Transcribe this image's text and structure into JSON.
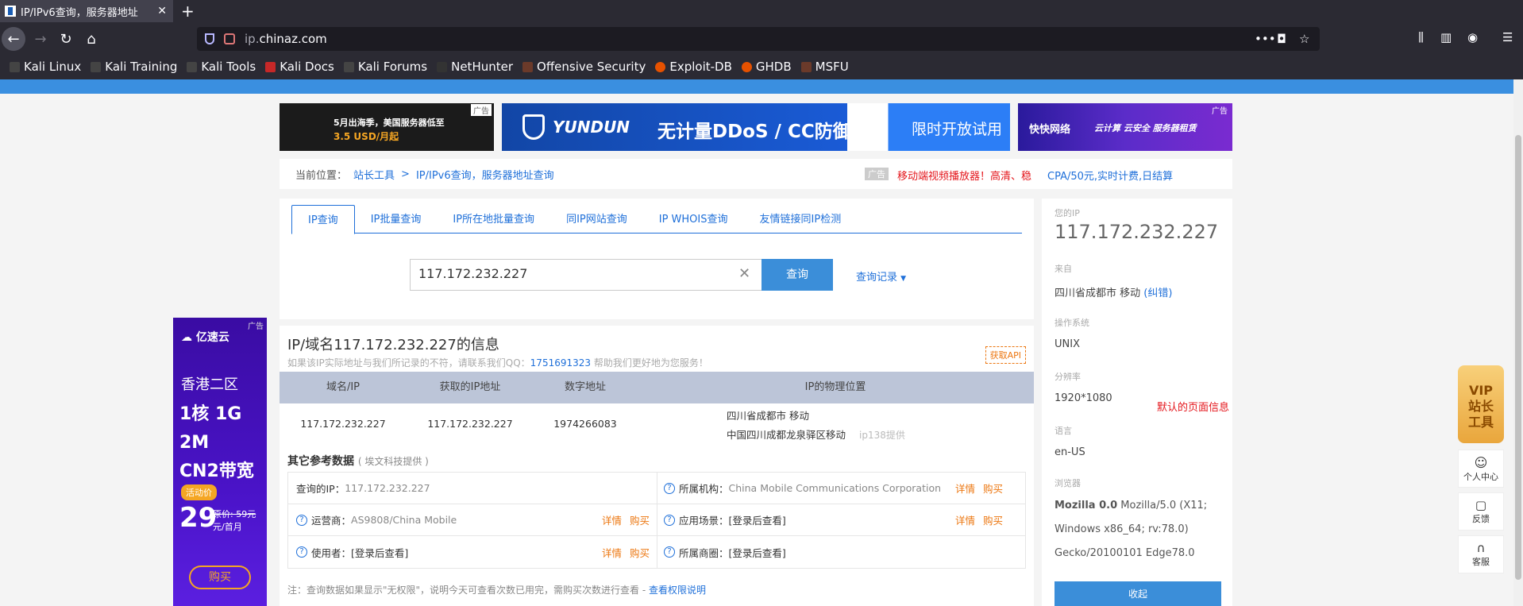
{
  "browser": {
    "tab_title": "IP/IPv6查询，服务器地址",
    "url_host": "ip.",
    "url_domain": "chinaz.com",
    "bookmarks": [
      "Kali Linux",
      "Kali Training",
      "Kali Tools",
      "Kali Docs",
      "Kali Forums",
      "NetHunter",
      "Offensive Security",
      "Exploit-DB",
      "GHDB",
      "MSFU"
    ]
  },
  "ads": {
    "top1_line1": "5月出海季，美国服务器低至",
    "top1_line2": "3.5 USD/月起",
    "top1_tag": "广告",
    "top2_brand": "YUNDUN",
    "top2_text": "无计量DDoS / CC防御",
    "top2_cta": "限时开放试用",
    "top3_brand": "快快网络",
    "top3_text": "云计算  云安全  服务器租赁",
    "left_brand": "亿速云",
    "left_t1": "香港二区",
    "left_t2a": "1核 1G 2M",
    "left_t2b": "CN2带宽",
    "left_badge": "活动价",
    "left_price": "29",
    "left_orig": "原价: 59元",
    "left_unit": "元/首月",
    "left_buy": "购买",
    "tag": "广告"
  },
  "crumb": {
    "label": "当前位置：",
    "home": "站长工具",
    "sep": ">",
    "current": "IP/IPv6查询，服务器地址查询",
    "tag": "广告",
    "red": "移动端视频播放器！高清、稳",
    "blue": "CPA/50元,实时计费,日结算"
  },
  "tabs": [
    "IP查询",
    "IP批量查询",
    "IP所在地批量查询",
    "同IP网站查询",
    "IP WHOIS查询",
    "友情链接同IP检测"
  ],
  "search": {
    "value": "117.172.232.227",
    "button": "查询",
    "history": "查询记录"
  },
  "info": {
    "title": "IP/域名117.172.232.227的信息",
    "note_pre": "如果该IP实际地址与我们所记录的不符，请联系我们QQ：",
    "qq": "1751691323",
    "note_post": " 帮助我们更好地为您服务！",
    "api": "获取API"
  },
  "table": {
    "headers": [
      "域名/IP",
      "获取的IP地址",
      "数字地址",
      "IP的物理位置"
    ],
    "row": [
      "117.172.232.227",
      "117.172.232.227",
      "1974266083"
    ],
    "loc1": "四川省成都市 移动",
    "loc2": "中国四川成都龙泉驿区移动",
    "source": "ip138提供"
  },
  "other": {
    "title": "其它参考数据",
    "source": "( 埃文科技提供 )",
    "q_ip_label": "查询的IP：",
    "q_ip": "117.172.232.227",
    "org_label": "所属机构：",
    "org": "China Mobile Communications Corporation",
    "isp_label": "运营商：",
    "isp": "AS9808/China Mobile",
    "scene_label": "应用场景：",
    "scene": "[登录后查看]",
    "user_label": "使用者：",
    "user": "[登录后查看]",
    "circle_label": "所属商圈：",
    "circle": "[登录后查看]",
    "detail": "详情",
    "buy": "购买"
  },
  "note": {
    "text": "注：查询数据如果显示\"无权限\"，说明今天可查看次数已用完，需购买次数进行查看 - ",
    "link": "查看权限说明"
  },
  "sidebar": {
    "your_ip_label": "您的IP",
    "your_ip": "117.172.232.227",
    "from_label": "来自",
    "from": "四川省成都市 移动",
    "fix": "(纠错)",
    "os_label": "操作系统",
    "os": "UNIX",
    "res_label": "分辨率",
    "res": "1920*1080",
    "default_note": "默认的页面信息",
    "lang_label": "语言",
    "lang": "en-US",
    "browser_label": "浏览器",
    "browser_bold": "Mozilla 0.0",
    "browser": " Mozilla/5.0 (X11; Windows x86_64; rv:78.0) Gecko/20100101 Edge78.0",
    "collapse": "收起"
  },
  "float": {
    "vip1": "VIP",
    "vip2": "站长",
    "vip3": "工具",
    "personal": "个人中心",
    "feedback": "反馈",
    "service": "客服"
  }
}
